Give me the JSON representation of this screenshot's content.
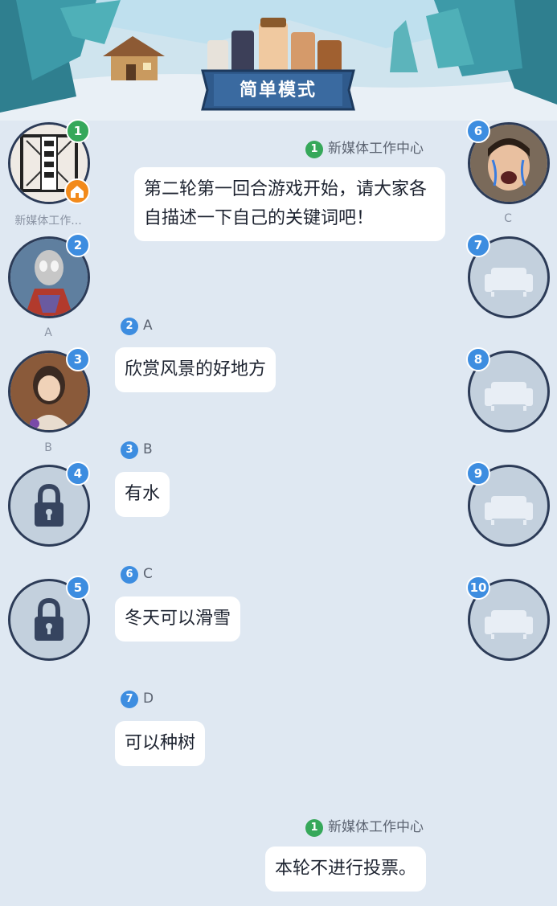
{
  "header": {
    "mode_title": "简单模式"
  },
  "seats_left": [
    {
      "num": "1",
      "name": "新媒体工作...",
      "host": true,
      "type": "portrait-seal"
    },
    {
      "num": "2",
      "name": "A",
      "type": "portrait-hero"
    },
    {
      "num": "3",
      "name": "B",
      "type": "portrait-girl"
    },
    {
      "num": "4",
      "name": "",
      "type": "locked"
    },
    {
      "num": "5",
      "name": "",
      "type": "locked"
    }
  ],
  "seats_right": [
    {
      "num": "6",
      "name": "C",
      "type": "portrait-meme"
    },
    {
      "num": "7",
      "name": "",
      "type": "empty-seat"
    },
    {
      "num": "8",
      "name": "",
      "type": "empty-seat"
    },
    {
      "num": "9",
      "name": "",
      "type": "empty-seat"
    },
    {
      "num": "10",
      "name": "",
      "type": "empty-seat"
    }
  ],
  "messages": [
    {
      "num": "1",
      "sender": "新媒体工作中心",
      "side": "right",
      "text": "第二轮第一回合游戏开始，请大家各自描述一下自己的关键词吧！"
    },
    {
      "num": "2",
      "sender": "A",
      "side": "left",
      "text": "欣赏风景的好地方"
    },
    {
      "num": "3",
      "sender": "B",
      "side": "left",
      "text": "有水"
    },
    {
      "num": "6",
      "sender": "C",
      "side": "left",
      "text": "冬天可以滑雪"
    },
    {
      "num": "7",
      "sender": "D",
      "side": "left",
      "text": "可以种树"
    },
    {
      "num": "1",
      "sender": "新媒体工作中心",
      "side": "right",
      "text": "本轮不进行投票。"
    }
  ],
  "colors": {
    "background": "#dfe8f2",
    "seat_badge": "#3d8de0",
    "host_badge": "#36a85a",
    "home_badge": "#f28a1b",
    "banner": "#2f5a8c"
  },
  "icons": [
    "house-icon",
    "lock-icon",
    "sofa-icon",
    "home-icon"
  ]
}
